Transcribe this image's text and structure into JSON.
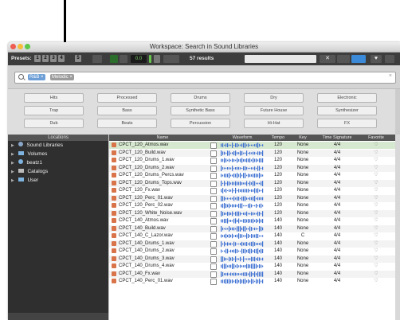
{
  "window": {
    "title": "Workspace: Search in Sound Libraries"
  },
  "toolbar": {
    "presets_label": "Presets:",
    "preset_buttons": [
      "1",
      "2",
      "3",
      "4",
      "5"
    ],
    "level_value": "0.0",
    "results_count": "57 results"
  },
  "search": {
    "tags": [
      "R&B",
      "Melodic"
    ],
    "value": "",
    "clear_label": "×"
  },
  "categories": [
    [
      "Hits",
      "Processed",
      "Drums",
      "Dry",
      "Electronic"
    ],
    [
      "Trap",
      "Bass",
      "Synthetic Bass",
      "Future House",
      "Synthesizer"
    ],
    [
      "Dub",
      "Beats",
      "Percussion",
      "Hi-Hat",
      "FX"
    ]
  ],
  "locations": {
    "header": "Locations",
    "items": [
      {
        "label": "Sound Libraries",
        "icon": "sound-library-icon"
      },
      {
        "label": "Volumes",
        "icon": "folder-icon"
      },
      {
        "label": "beatz1",
        "icon": "user-folder-icon"
      },
      {
        "label": "Catalogs",
        "icon": "catalog-icon"
      },
      {
        "label": "User",
        "icon": "folder-icon"
      }
    ]
  },
  "results": {
    "headers": {
      "name": "Name",
      "waveform": "Waveform",
      "tempo": "Tempo",
      "key": "Key",
      "time_signature": "Time Signature",
      "favorite": "Favorite"
    },
    "rows": [
      {
        "name": "CPCT_120_Atmos.wav",
        "tempo": "120",
        "key": "None",
        "ts": "4/4",
        "fav": "♡"
      },
      {
        "name": "CPCT_120_Build.wav",
        "tempo": "120",
        "key": "None",
        "ts": "4/4",
        "fav": "♡"
      },
      {
        "name": "CPCT_120_Drums_1.wav",
        "tempo": "120",
        "key": "None",
        "ts": "4/4",
        "fav": "♡"
      },
      {
        "name": "CPCT_120_Drums_2.wav",
        "tempo": "120",
        "key": "None",
        "ts": "4/4",
        "fav": "♡"
      },
      {
        "name": "CPCT_120_Drums_Percs.wav",
        "tempo": "120",
        "key": "None",
        "ts": "4/4",
        "fav": "♡"
      },
      {
        "name": "CPCT_120_Drums_Tops.wav",
        "tempo": "120",
        "key": "None",
        "ts": "4/4",
        "fav": "♡"
      },
      {
        "name": "CPCT_120_Fx.wav",
        "tempo": "120",
        "key": "None",
        "ts": "4/4",
        "fav": "♡"
      },
      {
        "name": "CPCT_120_Perc_01.wav",
        "tempo": "120",
        "key": "None",
        "ts": "4/4",
        "fav": "♡"
      },
      {
        "name": "CPCT_120_Perc_02.wav",
        "tempo": "120",
        "key": "None",
        "ts": "4/4",
        "fav": "♡"
      },
      {
        "name": "CPCT_120_White_Noise.wav",
        "tempo": "120",
        "key": "None",
        "ts": "4/4",
        "fav": "♡"
      },
      {
        "name": "CPCT_140_Atmos.wav",
        "tempo": "140",
        "key": "None",
        "ts": "4/4",
        "fav": "♡"
      },
      {
        "name": "CPCT_140_Build.wav",
        "tempo": "140",
        "key": "None",
        "ts": "4/4",
        "fav": "♡"
      },
      {
        "name": "CPCT_140_C_Lazor.wav",
        "tempo": "140",
        "key": "C",
        "ts": "4/4",
        "fav": "♡"
      },
      {
        "name": "CPCT_140_Drums_1.wav",
        "tempo": "140",
        "key": "None",
        "ts": "4/4",
        "fav": "♡"
      },
      {
        "name": "CPCT_140_Drums_2.wav",
        "tempo": "140",
        "key": "None",
        "ts": "4/4",
        "fav": "♡"
      },
      {
        "name": "CPCT_140_Drums_3.wav",
        "tempo": "140",
        "key": "None",
        "ts": "4/4",
        "fav": "♡"
      },
      {
        "name": "CPCT_140_Drums_4.wav",
        "tempo": "140",
        "key": "None",
        "ts": "4/4",
        "fav": "♡"
      },
      {
        "name": "CPCT_140_Fx.wav",
        "tempo": "140",
        "key": "None",
        "ts": "4/4",
        "fav": "♡"
      },
      {
        "name": "CPCT_140_Perc_01.wav",
        "tempo": "140",
        "key": "None",
        "ts": "4/4",
        "fav": "♡"
      }
    ]
  },
  "colors": {
    "selected_row": "#d6e8cf",
    "waveform": "#3b6fd1",
    "accent": "#6d9fd6"
  }
}
